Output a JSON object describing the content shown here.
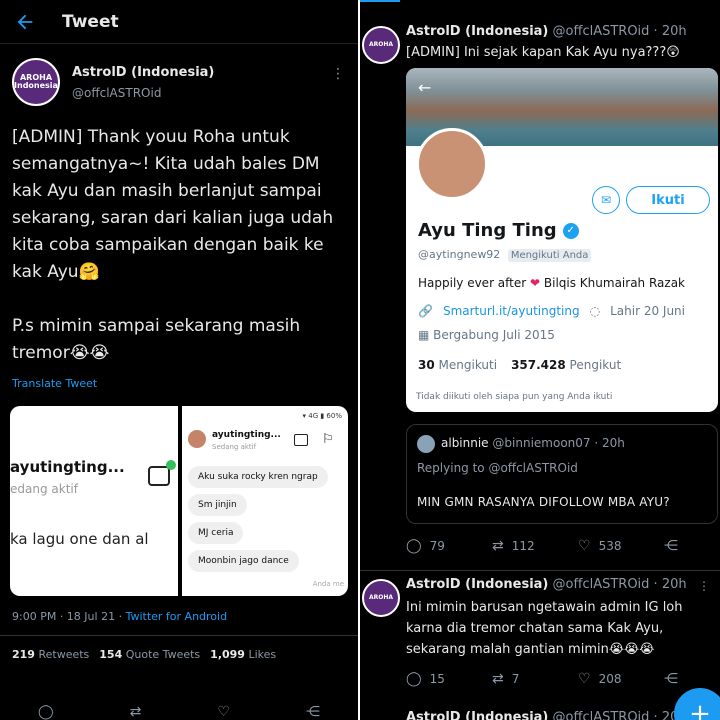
{
  "left": {
    "header": {
      "title": "Tweet"
    },
    "tweet": {
      "author_name": "AstrolD (Indonesia)",
      "author_handle": "@offclASTROid",
      "avatar_text": "AROHA Indonesia",
      "body": "[ADMIN] Thank youu Roha untuk semangatnya~! Kita udah bales DM kak Ayu dan masih berlanjut sampai sekarang, saran dari kalian juga udah kita coba sampaikan dengan baik ke kak Ayu🤗\n\nP.s mimin sampai sekarang masih tremor😭😭",
      "translate": "Translate Tweet",
      "media": {
        "a_name": "ayutingting...",
        "a_status": "edang aktif",
        "a_line": "ka lagu one dan al",
        "b_status_bar": "▾ 4G ▮ 60%",
        "b_name": "ayutingting...",
        "b_active": "Sedang aktif",
        "bubbles": [
          "Aku suka rocky kren ngrap",
          "Sm jinjin",
          "MJ ceria",
          "Moonbin jago dance"
        ],
        "b_time": "Anda me"
      },
      "meta_time": "9:00 PM · 18 Jul 21 · ",
      "meta_source": "Twitter for Android",
      "stats": {
        "retweets": "219",
        "retweets_label": "Retweets",
        "quotes": "154",
        "quotes_label": "Quote Tweets",
        "likes": "1,099",
        "likes_label": "Likes"
      }
    }
  },
  "right": {
    "tweet1": {
      "author_name": "AstrolD (Indonesia)",
      "handle_time": "@offclASTROid · 20h",
      "text": "[ADMIN] Ini sejak kapan Kak Ayu nya???😲",
      "profile": {
        "name": "Ayu Ting Ting",
        "handle": "@aytingnew92",
        "follows_you": "Mengikuti Anda",
        "follow_button": "Ikuti",
        "bio_before": "Happily ever after ",
        "bio_after": " Bilqis Khumairah Razak",
        "link": "Smarturl.it/ayutingting",
        "birthday": "Lahir 20 Juni",
        "joined": "Bergabung Juli 2015",
        "following_count": "30",
        "following_label": "Mengikuti",
        "followers_count": "357.428",
        "followers_label": "Pengikut",
        "not_followed": "Tidak diikuti oleh siapa pun yang Anda ikuti"
      },
      "quote": {
        "name": "albinnie",
        "handle_time": "@binniemoon07 · 20h",
        "replying": "Replying to @offclASTROid",
        "text": "MIN GMN RASANYA DIFOLLOW MBA AYU?"
      },
      "replies": "79",
      "retweets": "112",
      "likes": "538"
    },
    "tweet2": {
      "author_name": "AstrolD (Indonesia)",
      "handle_time": "@offclASTROid · 20h",
      "text": "Ini mimin barusan ngetawain admin IG loh karna dia tremor chatan sama Kak Ayu, sekarang malah gantian mimin😭😭😭",
      "replies": "15",
      "retweets": "7",
      "likes": "208"
    },
    "tweet3": {
      "author_name": "AstrolD (Indonesia)",
      "handle_time": "@offclASTROid · 20h"
    }
  }
}
